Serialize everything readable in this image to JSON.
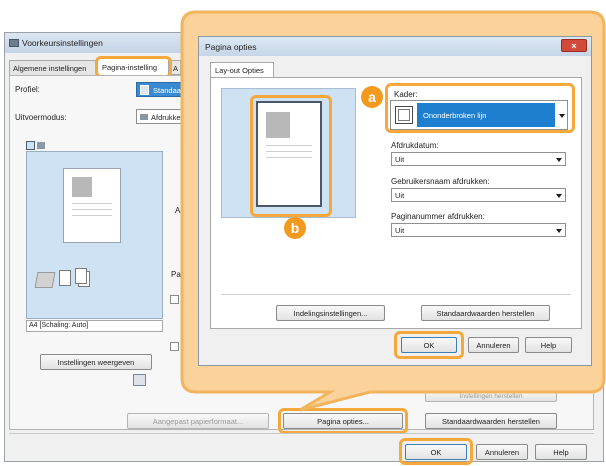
{
  "background_dialog": {
    "title": "Voorkeursinstellingen",
    "tabs": [
      "Algemene instellingen",
      "Pagina-instelling",
      "A"
    ],
    "profile_label": "Profiel:",
    "profile_value": "Standaard",
    "output_mode_label": "Uitvoermodus:",
    "output_mode_value": "Afdrukken",
    "paper_status": "A4 [Schaling: Auto]",
    "view_settings_button": "Instellingen weergeven",
    "partial_labels": [
      "Af",
      "Pag"
    ],
    "custom_paper_button": "Aangepast papierformaat...",
    "page_options_button": "Pagina opties...",
    "restore_defaults_button": "Standaardwaarden herstellen",
    "partial_button_text": "Instellingen herstellen",
    "ok_button": "OK",
    "cancel_button": "Annuleren",
    "help_button": "Help"
  },
  "popup_dialog": {
    "title": "Pagina opties",
    "tab": "Lay-out Opties",
    "frame_label": "Kader:",
    "frame_value": "Ononderbroken lijn",
    "print_date_label": "Afdrukdatum:",
    "print_date_value": "Uit",
    "print_username_label": "Gebruikersnaam afdrukken:",
    "print_username_value": "Uit",
    "print_page_numbers_label": "Paginanummer afdrukken:",
    "print_page_numbers_value": "Uit",
    "layout_settings_button": "Indelingsinstellingen...",
    "restore_defaults_button": "Standaardwaarden herstellen",
    "ok_button": "OK",
    "cancel_button": "Annuleren",
    "help_button": "Help"
  },
  "callouts": {
    "a": "a",
    "b": "b"
  },
  "colors": {
    "callout_orange": "#f39a1e",
    "highlight_orange": "#f6a83a",
    "callout_panel": "#fbd29a",
    "preview_blue": "#cfe2f4",
    "selected_blue": "#1e7fd0",
    "close_red": "#d24a3a"
  }
}
